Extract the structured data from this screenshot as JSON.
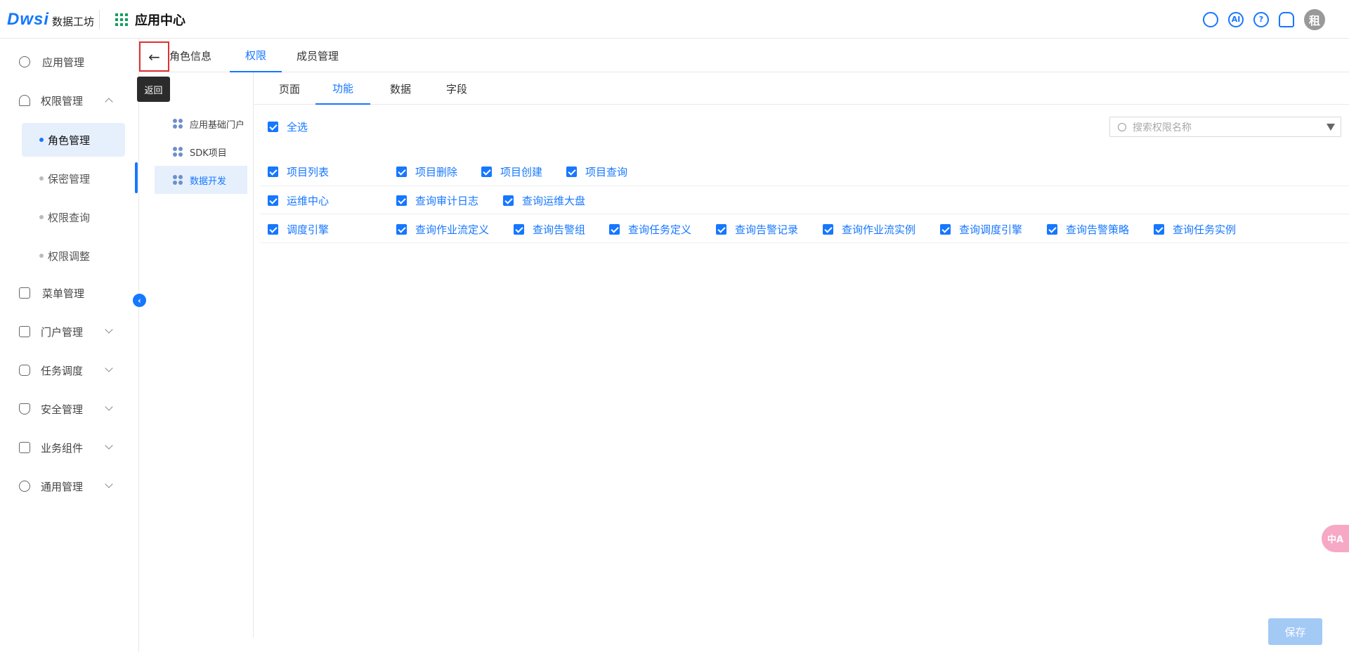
{
  "header": {
    "logo_mark": "Dwsi",
    "logo_text": "数据工坊",
    "app_center": "应用中心",
    "ai_label": "AI",
    "help_label": "?",
    "avatar_text": "租"
  },
  "sidebar": {
    "items": [
      {
        "label": "应用管理"
      },
      {
        "label": "权限管理"
      },
      {
        "label": "菜单管理"
      },
      {
        "label": "门户管理"
      },
      {
        "label": "任务调度"
      },
      {
        "label": "安全管理"
      },
      {
        "label": "业务组件"
      },
      {
        "label": "通用管理"
      }
    ],
    "sub_items": [
      {
        "label": "角色管理"
      },
      {
        "label": "保密管理"
      },
      {
        "label": "权限查询"
      },
      {
        "label": "权限调整"
      }
    ]
  },
  "back": {
    "tooltip": "返回"
  },
  "main_tabs": [
    {
      "label": "角色信息"
    },
    {
      "label": "权限"
    },
    {
      "label": "成员管理"
    }
  ],
  "app_list": [
    {
      "label": "应用基础门户"
    },
    {
      "label": "SDK项目"
    },
    {
      "label": "数据开发"
    }
  ],
  "sub_tabs": [
    {
      "label": "页面"
    },
    {
      "label": "功能"
    },
    {
      "label": "数据"
    },
    {
      "label": "字段"
    }
  ],
  "select_all": "全选",
  "search": {
    "placeholder": "搜索权限名称"
  },
  "permissions": [
    {
      "group": "项目列表",
      "items": [
        "项目删除",
        "项目创建",
        "项目查询"
      ]
    },
    {
      "group": "运维中心",
      "items": [
        "查询审计日志",
        "查询运维大盘"
      ]
    },
    {
      "group": "调度引擎",
      "items": [
        "查询作业流定义",
        "查询告警组",
        "查询任务定义",
        "查询告警记录",
        "查询作业流实例",
        "查询调度引擎",
        "查询告警策略",
        "查询任务实例"
      ]
    }
  ],
  "save_label": "保存",
  "float_label": "中A",
  "colors": {
    "accent": "#1677ff",
    "active_bg": "#e6f0fc",
    "save_disabled": "#a3c9f5"
  }
}
